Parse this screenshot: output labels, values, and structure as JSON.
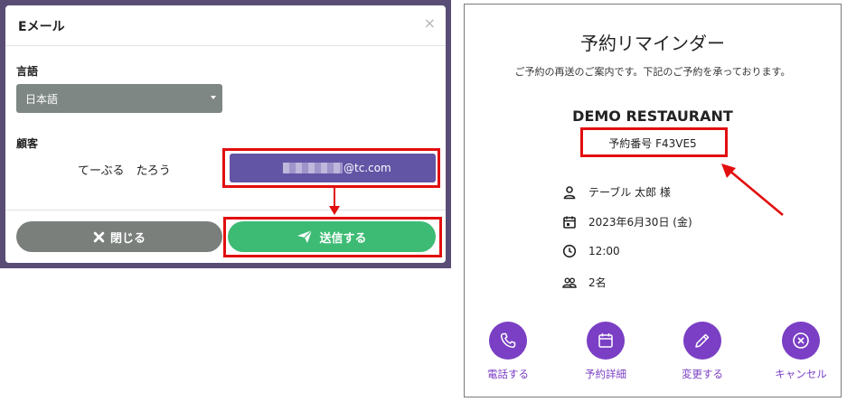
{
  "email_modal": {
    "title": "Eメール",
    "close_glyph": "×",
    "language_label": "言語",
    "language_value": "日本語",
    "customer_label": "顧客",
    "customer_name": "てーぶる　たろう",
    "customer_email_domain": "@tc.com",
    "close_button": "閉じる",
    "send_button": "送信する"
  },
  "reminder": {
    "title": "予約リマインダー",
    "subtitle": "ご予約の再送のご案内です。下記のご予約を承っております。",
    "restaurant": "DEMO RESTAURANT",
    "reservation_number": "予約番号 F43VE5",
    "details": [
      {
        "icon": "person-icon",
        "text": "テーブル 太郎 様"
      },
      {
        "icon": "calendar-icon",
        "text": "2023年6月30日 (金)"
      },
      {
        "icon": "clock-icon",
        "text": "12:00"
      },
      {
        "icon": "people-icon",
        "text": "2名"
      }
    ],
    "actions": [
      {
        "icon": "phone-icon",
        "label": "電話する"
      },
      {
        "icon": "calendar-icon",
        "label": "予約詳細"
      },
      {
        "icon": "pencil-icon",
        "label": "変更する"
      },
      {
        "icon": "cancel-icon",
        "label": "キャンセル"
      }
    ]
  },
  "colors": {
    "accent_purple": "#7a3fc4",
    "send_green": "#3dbb74",
    "email_button_purple": "#6355a6",
    "highlight_red": "#e20e0e"
  }
}
